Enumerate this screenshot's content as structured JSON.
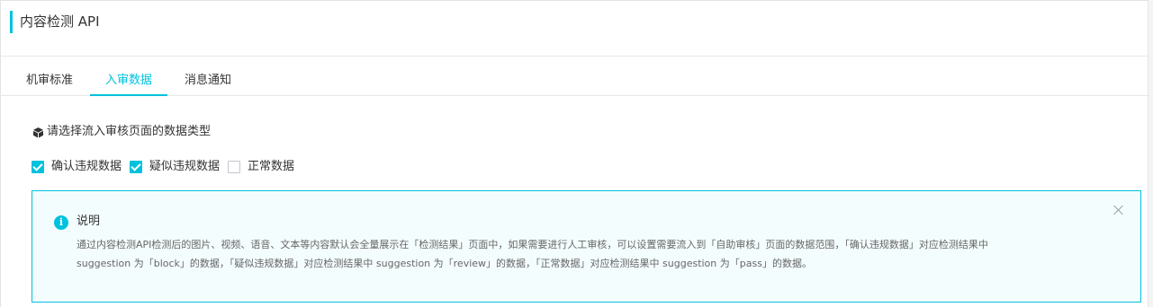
{
  "header": {
    "title": "内容检测 API"
  },
  "tabs": [
    {
      "label": "机审标准",
      "active": false
    },
    {
      "label": "入审数据",
      "active": true
    },
    {
      "label": "消息通知",
      "active": false
    }
  ],
  "section": {
    "title": "请选择流入审核页面的数据类型",
    "icon": "cube-icon"
  },
  "checkboxes": [
    {
      "label": "确认违规数据",
      "checked": true
    },
    {
      "label": "疑似违规数据",
      "checked": true
    },
    {
      "label": "正常数据",
      "checked": false
    }
  ],
  "notice": {
    "title": "说明",
    "icon": "info-icon",
    "line1": "通过内容检测API检测后的图片、视频、语音、文本等内容默认会全量展示在「检测结果」页面中，如果需要进行人工审核，可以设置需要流入到「自助审核」页面的数据范围，「确认违规数据」对应检测结果中",
    "line2": "suggestion 为「block」的数据，「疑似违规数据」对应检测结果中 suggestion 为「review」的数据，「正常数据」对应检测结果中 suggestion 为「pass」的数据。",
    "close_icon": "close-icon"
  },
  "colors": {
    "accent": "#00c1de",
    "notice_bg": "#f4fdfe"
  }
}
